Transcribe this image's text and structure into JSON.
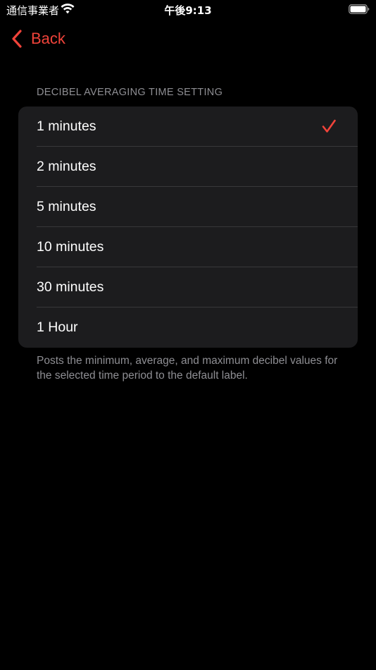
{
  "status_bar": {
    "carrier": "通信事業者",
    "time": "午後9:13",
    "wifi_icon": "wifi-icon",
    "battery_icon": "battery-icon"
  },
  "nav": {
    "back_label": "Back",
    "back_icon": "chevron-left-icon"
  },
  "section": {
    "header": "DECIBEL AVERAGING TIME SETTING",
    "options": [
      {
        "label": "1 minutes",
        "selected": true
      },
      {
        "label": "2 minutes",
        "selected": false
      },
      {
        "label": "5 minutes",
        "selected": false
      },
      {
        "label": "10 minutes",
        "selected": false
      },
      {
        "label": "30 minutes",
        "selected": false
      },
      {
        "label": "1 Hour",
        "selected": false
      }
    ],
    "footer": "Posts the minimum, average, and maximum decibel values for the selected time period to the default label."
  },
  "colors": {
    "accent": "#f0433a",
    "background": "#000000",
    "group_background": "#1c1c1e",
    "secondary_text": "#8e8e93",
    "separator": "#38383a"
  }
}
